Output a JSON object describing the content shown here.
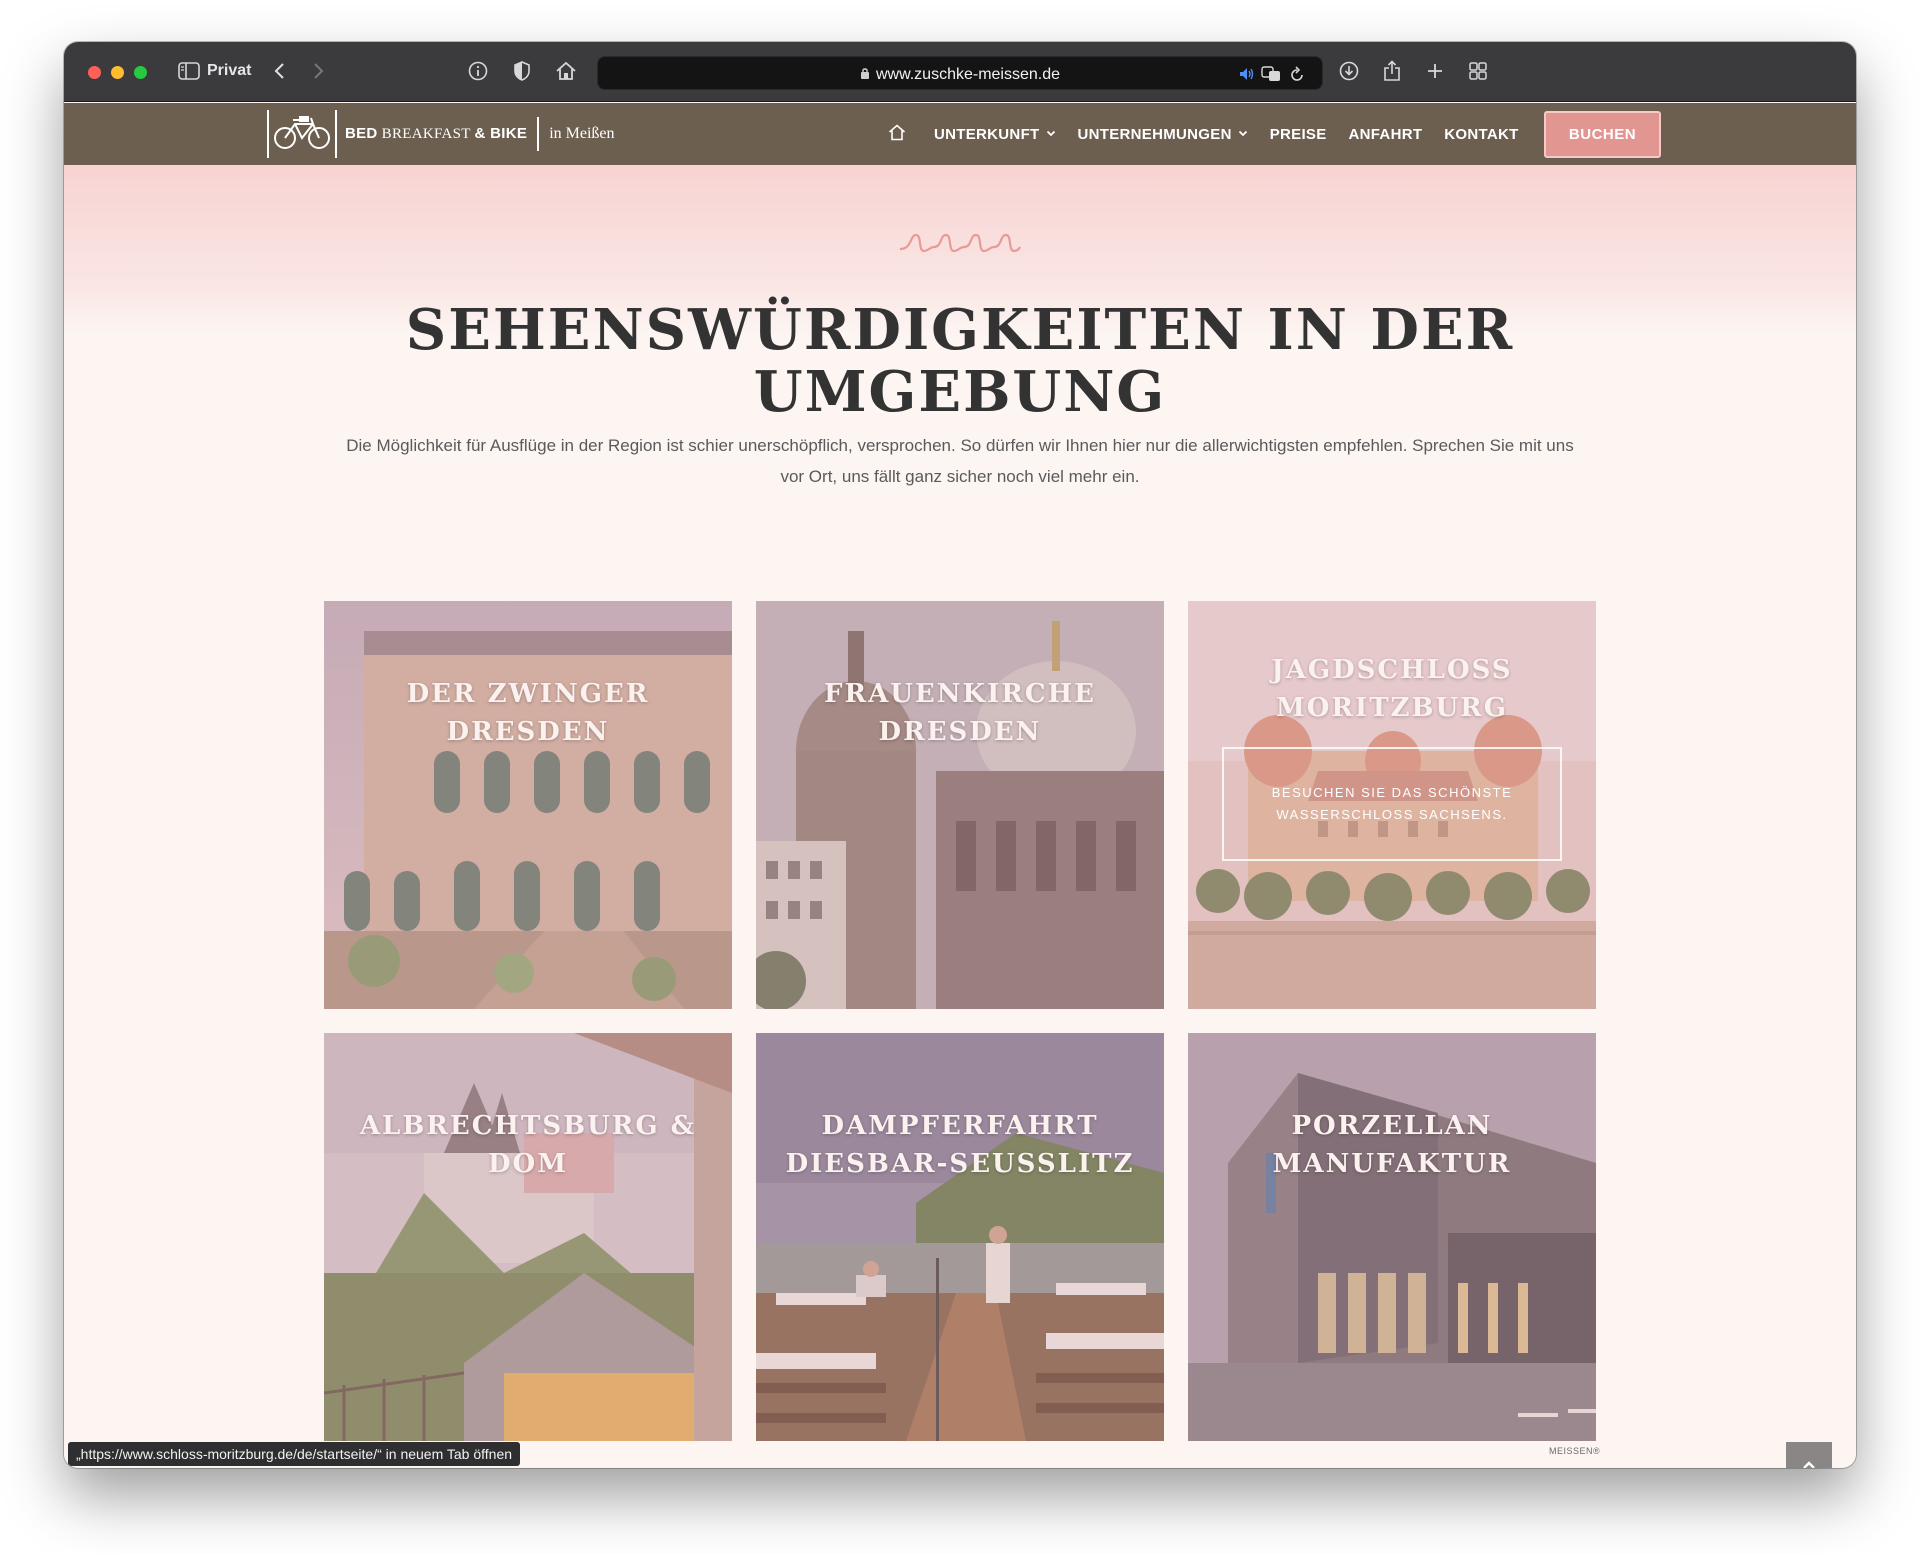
{
  "browser": {
    "private_label": "Privat",
    "url": "www.zuschke-meissen.de",
    "status_link": "„https://www.schloss-moritzburg.de/de/startseite/“ in neuem Tab öffnen"
  },
  "site": {
    "logo": {
      "brand_bold_1": "BED",
      "brand_serif": "BREAKFAST",
      "brand_bold_2": "& BIKE",
      "location": "in Meißen"
    },
    "nav": {
      "items": [
        {
          "label": "UNTERKUNFT",
          "dropdown": true
        },
        {
          "label": "UNTERNEHMUNGEN",
          "dropdown": true
        },
        {
          "label": "PREISE",
          "dropdown": false
        },
        {
          "label": "ANFAHRT",
          "dropdown": false
        },
        {
          "label": "KONTAKT",
          "dropdown": false
        }
      ],
      "cta": "BUCHEN"
    },
    "colors": {
      "header_bg": "#6d5f50",
      "accent": "#e29692",
      "page_bg": "#fcf5f2"
    }
  },
  "main": {
    "heading_line1": "SEHENSWÜRDIGKEITEN IN DER",
    "heading_line2": "UMGEBUNG",
    "intro_line1": "Die Möglichkeit für Ausflüge in der Region ist schier unerschöpflich, versprochen. So dürfen wir Ihnen hier nur die allerwichtigsten empfehlen. Sprechen Sie mit uns",
    "intro_line2": "vor Ort, uns fällt ganz sicher noch viel mehr ein.",
    "tiles": [
      {
        "line1": "DER ZWINGER",
        "line2": "DRESDEN"
      },
      {
        "line1": "FRAUENKIRCHE",
        "line2": "DRESDEN"
      },
      {
        "line1": "JAGDSCHLOSS",
        "line2": "MORITZBURG",
        "hover_text": "BESUCHEN SIE DAS SCHÖNSTE WASSERSCHLOSS SACHSENS."
      },
      {
        "line1": "ALBRECHTSBURG &",
        "line2": "DOM"
      },
      {
        "line1": "DAMPFERFAHRT",
        "line2": "DIESBAR-SEUSSLITZ"
      },
      {
        "line1": "PORZELLAN",
        "line2": "MANUFAKTUR"
      }
    ],
    "copyright": "MEISSEN®"
  }
}
